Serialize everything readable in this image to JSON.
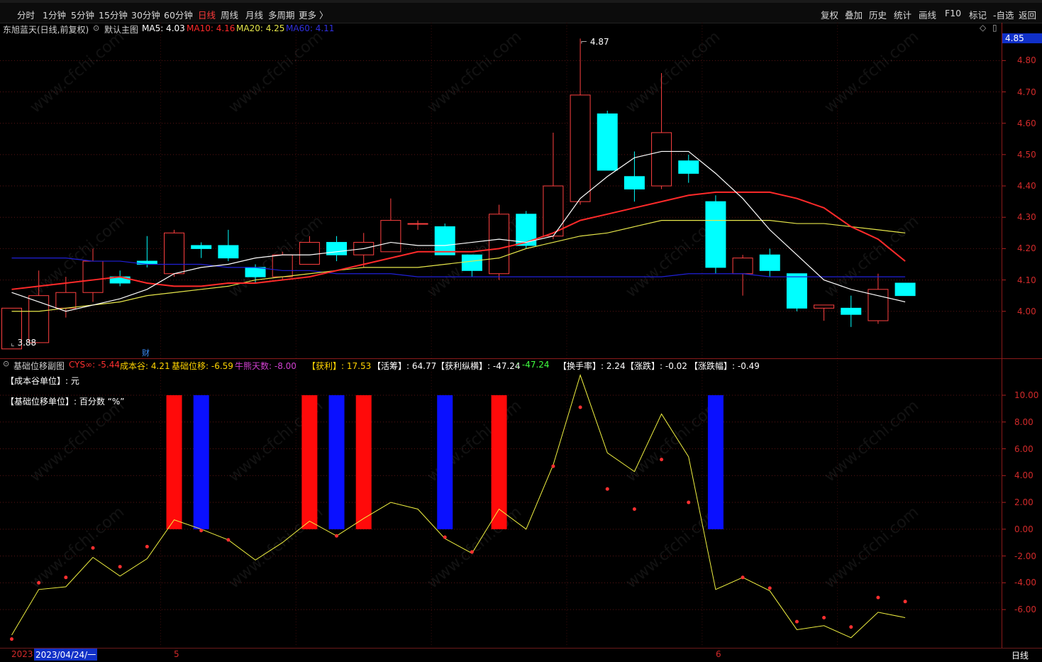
{
  "colors": {
    "up": "#ff4040",
    "down": "#00ffff",
    "ma5": "#ffffff",
    "ma10": "#ff2a2a",
    "ma20": "#e6e64a",
    "ma60": "#2020d8",
    "accent": "#ff3a3a",
    "grid": "#5a1414",
    "purple": "#d040d0"
  },
  "timeframes": [
    "分时",
    "1分钟",
    "5分钟",
    "15分钟",
    "30分钟",
    "60分钟",
    "日线",
    "周线",
    "月线",
    "多周期",
    "更多 〉"
  ],
  "active_timeframe": "日线",
  "right_toolbar": [
    "复权",
    "叠加",
    "历史",
    "统计",
    "画线",
    "F10",
    "标记",
    "-自选",
    "返回"
  ],
  "main_panel": {
    "stock_title": "东旭蓝天(日线,前复权)",
    "template": "默认主图",
    "ma5": "MA5: 4.03",
    "ma10": "MA10: 4.16",
    "ma20": "MA20: 4.25",
    "ma60": "MA60: 4.11",
    "current_price": "4.85",
    "high_label": "4.87",
    "low_label": "3.88",
    "cai_label": "财",
    "y_ticks": [
      "4.80",
      "4.70",
      "4.60",
      "4.50",
      "4.40",
      "4.30",
      "4.20",
      "4.10",
      "4.00"
    ]
  },
  "sub_panel": {
    "name": "基础位移副图",
    "cys": "CYS∞: -5.44",
    "cost": "成本谷: 4.21",
    "shift": "基础位移: -6.59",
    "bull_days": "牛熊天数: -8.00",
    "profit": "【获利】: 17.53",
    "active_chips": "【活筹】: 64.77",
    "profit_span": "【获利纵横】: -47.24",
    "profit_span2": ": -47.24",
    "turnover": "【换手率】: 2.24",
    "change": "【涨跌】: -0.02",
    "change_pct": "【涨跌幅】: -0.49",
    "unit1": "【成本谷单位】: 元",
    "unit2": "【基础位移单位】: 百分数 “%”",
    "y_ticks": [
      "10.00",
      "8.00",
      "6.00",
      "4.00",
      "2.00",
      "0.00",
      "-2.00",
      "-4.00",
      "-6.00"
    ]
  },
  "bottom": {
    "year": "2023",
    "date": "2023/04/24/一",
    "month5": "5",
    "month6": "6",
    "period": "日线"
  },
  "chart_data": [
    {
      "type": "candlestick",
      "title": "东旭蓝天(日线,前复权)",
      "ylim": [
        3.85,
        4.88
      ],
      "candles": [
        {
          "o": 3.88,
          "h": 4.01,
          "l": 3.88,
          "c": 4.01
        },
        {
          "o": 3.9,
          "h": 4.13,
          "l": 3.9,
          "c": 4.05
        },
        {
          "o": 4.01,
          "h": 4.11,
          "l": 3.98,
          "c": 4.06
        },
        {
          "o": 4.06,
          "h": 4.2,
          "l": 4.03,
          "c": 4.16
        },
        {
          "o": 4.11,
          "h": 4.13,
          "l": 4.08,
          "c": 4.09
        },
        {
          "o": 4.16,
          "h": 4.24,
          "l": 4.14,
          "c": 4.15
        },
        {
          "o": 4.12,
          "h": 4.26,
          "l": 4.11,
          "c": 4.25
        },
        {
          "o": 4.21,
          "h": 4.22,
          "l": 4.17,
          "c": 4.2
        },
        {
          "o": 4.21,
          "h": 4.26,
          "l": 4.16,
          "c": 4.17
        },
        {
          "o": 4.14,
          "h": 4.15,
          "l": 4.09,
          "c": 4.11
        },
        {
          "o": 4.11,
          "h": 4.19,
          "l": 4.1,
          "c": 4.18
        },
        {
          "o": 4.15,
          "h": 4.24,
          "l": 4.15,
          "c": 4.22
        },
        {
          "o": 4.22,
          "h": 4.24,
          "l": 4.16,
          "c": 4.18
        },
        {
          "o": 4.18,
          "h": 4.25,
          "l": 4.14,
          "c": 4.22
        },
        {
          "o": 4.19,
          "h": 4.36,
          "l": 4.19,
          "c": 4.29
        },
        {
          "o": 4.28,
          "h": 4.29,
          "l": 4.26,
          "c": 4.28
        },
        {
          "o": 4.27,
          "h": 4.28,
          "l": 4.18,
          "c": 4.18
        },
        {
          "o": 4.18,
          "h": 4.18,
          "l": 4.11,
          "c": 4.13
        },
        {
          "o": 4.12,
          "h": 4.34,
          "l": 4.1,
          "c": 4.31
        },
        {
          "o": 4.31,
          "h": 4.32,
          "l": 4.2,
          "c": 4.21
        },
        {
          "o": 4.24,
          "h": 4.57,
          "l": 4.23,
          "c": 4.4
        },
        {
          "o": 4.35,
          "h": 4.87,
          "l": 4.34,
          "c": 4.69
        },
        {
          "o": 4.63,
          "h": 4.64,
          "l": 4.45,
          "c": 4.45
        },
        {
          "o": 4.43,
          "h": 4.51,
          "l": 4.35,
          "c": 4.39
        },
        {
          "o": 4.4,
          "h": 4.76,
          "l": 4.39,
          "c": 4.57
        },
        {
          "o": 4.48,
          "h": 4.5,
          "l": 4.41,
          "c": 4.44
        },
        {
          "o": 4.35,
          "h": 4.37,
          "l": 4.12,
          "c": 4.14
        },
        {
          "o": 4.12,
          "h": 4.18,
          "l": 4.05,
          "c": 4.17
        },
        {
          "o": 4.18,
          "h": 4.2,
          "l": 4.11,
          "c": 4.13
        },
        {
          "o": 4.12,
          "h": 4.12,
          "l": 4.0,
          "c": 4.01
        },
        {
          "o": 4.01,
          "h": 4.02,
          "l": 3.97,
          "c": 4.02
        },
        {
          "o": 4.01,
          "h": 4.05,
          "l": 3.95,
          "c": 3.99
        },
        {
          "o": 3.97,
          "h": 4.12,
          "l": 3.96,
          "c": 4.07
        },
        {
          "o": 4.09,
          "h": 4.09,
          "l": 4.05,
          "c": 4.05
        }
      ],
      "ma5": [
        4.06,
        4.03,
        4.0,
        4.02,
        4.04,
        4.07,
        4.12,
        4.14,
        4.15,
        4.17,
        4.18,
        4.18,
        4.19,
        4.2,
        4.22,
        4.21,
        4.21,
        4.22,
        4.23,
        4.22,
        4.24,
        4.36,
        4.43,
        4.49,
        4.51,
        4.51,
        4.44,
        4.36,
        4.26,
        4.18,
        4.1,
        4.07,
        4.05,
        4.03
      ],
      "ma10": [
        4.07,
        4.08,
        4.09,
        4.1,
        4.11,
        4.09,
        4.08,
        4.08,
        4.09,
        4.09,
        4.1,
        4.11,
        4.13,
        4.15,
        4.17,
        4.19,
        4.19,
        4.19,
        4.2,
        4.22,
        4.25,
        4.29,
        4.31,
        4.33,
        4.35,
        4.37,
        4.38,
        4.38,
        4.38,
        4.36,
        4.33,
        4.27,
        4.23,
        4.16
      ],
      "ma20": [
        4.0,
        4.0,
        4.01,
        4.02,
        4.03,
        4.05,
        4.06,
        4.07,
        4.08,
        4.1,
        4.11,
        4.12,
        4.13,
        4.14,
        4.14,
        4.14,
        4.15,
        4.16,
        4.17,
        4.2,
        4.22,
        4.24,
        4.25,
        4.27,
        4.29,
        4.29,
        4.29,
        4.29,
        4.29,
        4.28,
        4.28,
        4.27,
        4.26,
        4.25
      ],
      "ma60": [
        4.17,
        4.17,
        4.17,
        4.16,
        4.16,
        4.15,
        4.15,
        4.15,
        4.14,
        4.14,
        4.13,
        4.13,
        4.12,
        4.12,
        4.12,
        4.11,
        4.11,
        4.11,
        4.11,
        4.11,
        4.11,
        4.11,
        4.11,
        4.11,
        4.11,
        4.12,
        4.12,
        4.12,
        4.11,
        4.11,
        4.11,
        4.11,
        4.11,
        4.11
      ]
    },
    {
      "type": "line",
      "title": "基础位移副图",
      "ylim": [
        -8.8,
        11.8
      ],
      "line": [
        -7.9,
        -4.5,
        -4.3,
        -2.1,
        -3.5,
        -2.2,
        0.7,
        0.0,
        -0.8,
        -2.3,
        -1.0,
        0.6,
        -0.5,
        0.8,
        2.0,
        1.5,
        -0.7,
        -1.8,
        1.5,
        0.0,
        4.8,
        11.5,
        5.7,
        4.3,
        8.6,
        5.4,
        -4.5,
        -3.6,
        -4.6,
        -7.5,
        -7.2,
        -8.1,
        -6.2,
        -6.6
      ],
      "dots": [
        -8.2,
        -4.0,
        -3.6,
        -1.4,
        -2.8,
        -1.3,
        null,
        -0.1,
        -0.8,
        null,
        null,
        null,
        -0.5,
        null,
        null,
        null,
        -0.6,
        -1.7,
        null,
        null,
        4.7,
        9.1,
        3.0,
        1.5,
        5.2,
        2.0,
        null,
        -3.6,
        -4.4,
        -6.9,
        -6.6,
        -7.3,
        -5.1,
        -5.4
      ],
      "bars": [
        {
          "index": 6,
          "color": "red",
          "value": 10
        },
        {
          "index": 7,
          "color": "blue",
          "value": 10
        },
        {
          "index": 11,
          "color": "red",
          "value": 10
        },
        {
          "index": 12,
          "color": "blue",
          "value": 10
        },
        {
          "index": 13,
          "color": "red",
          "value": 10
        },
        {
          "index": 16,
          "color": "blue",
          "value": 10
        },
        {
          "index": 18,
          "color": "red",
          "value": 10
        },
        {
          "index": 26,
          "color": "blue",
          "value": 10
        }
      ]
    }
  ]
}
